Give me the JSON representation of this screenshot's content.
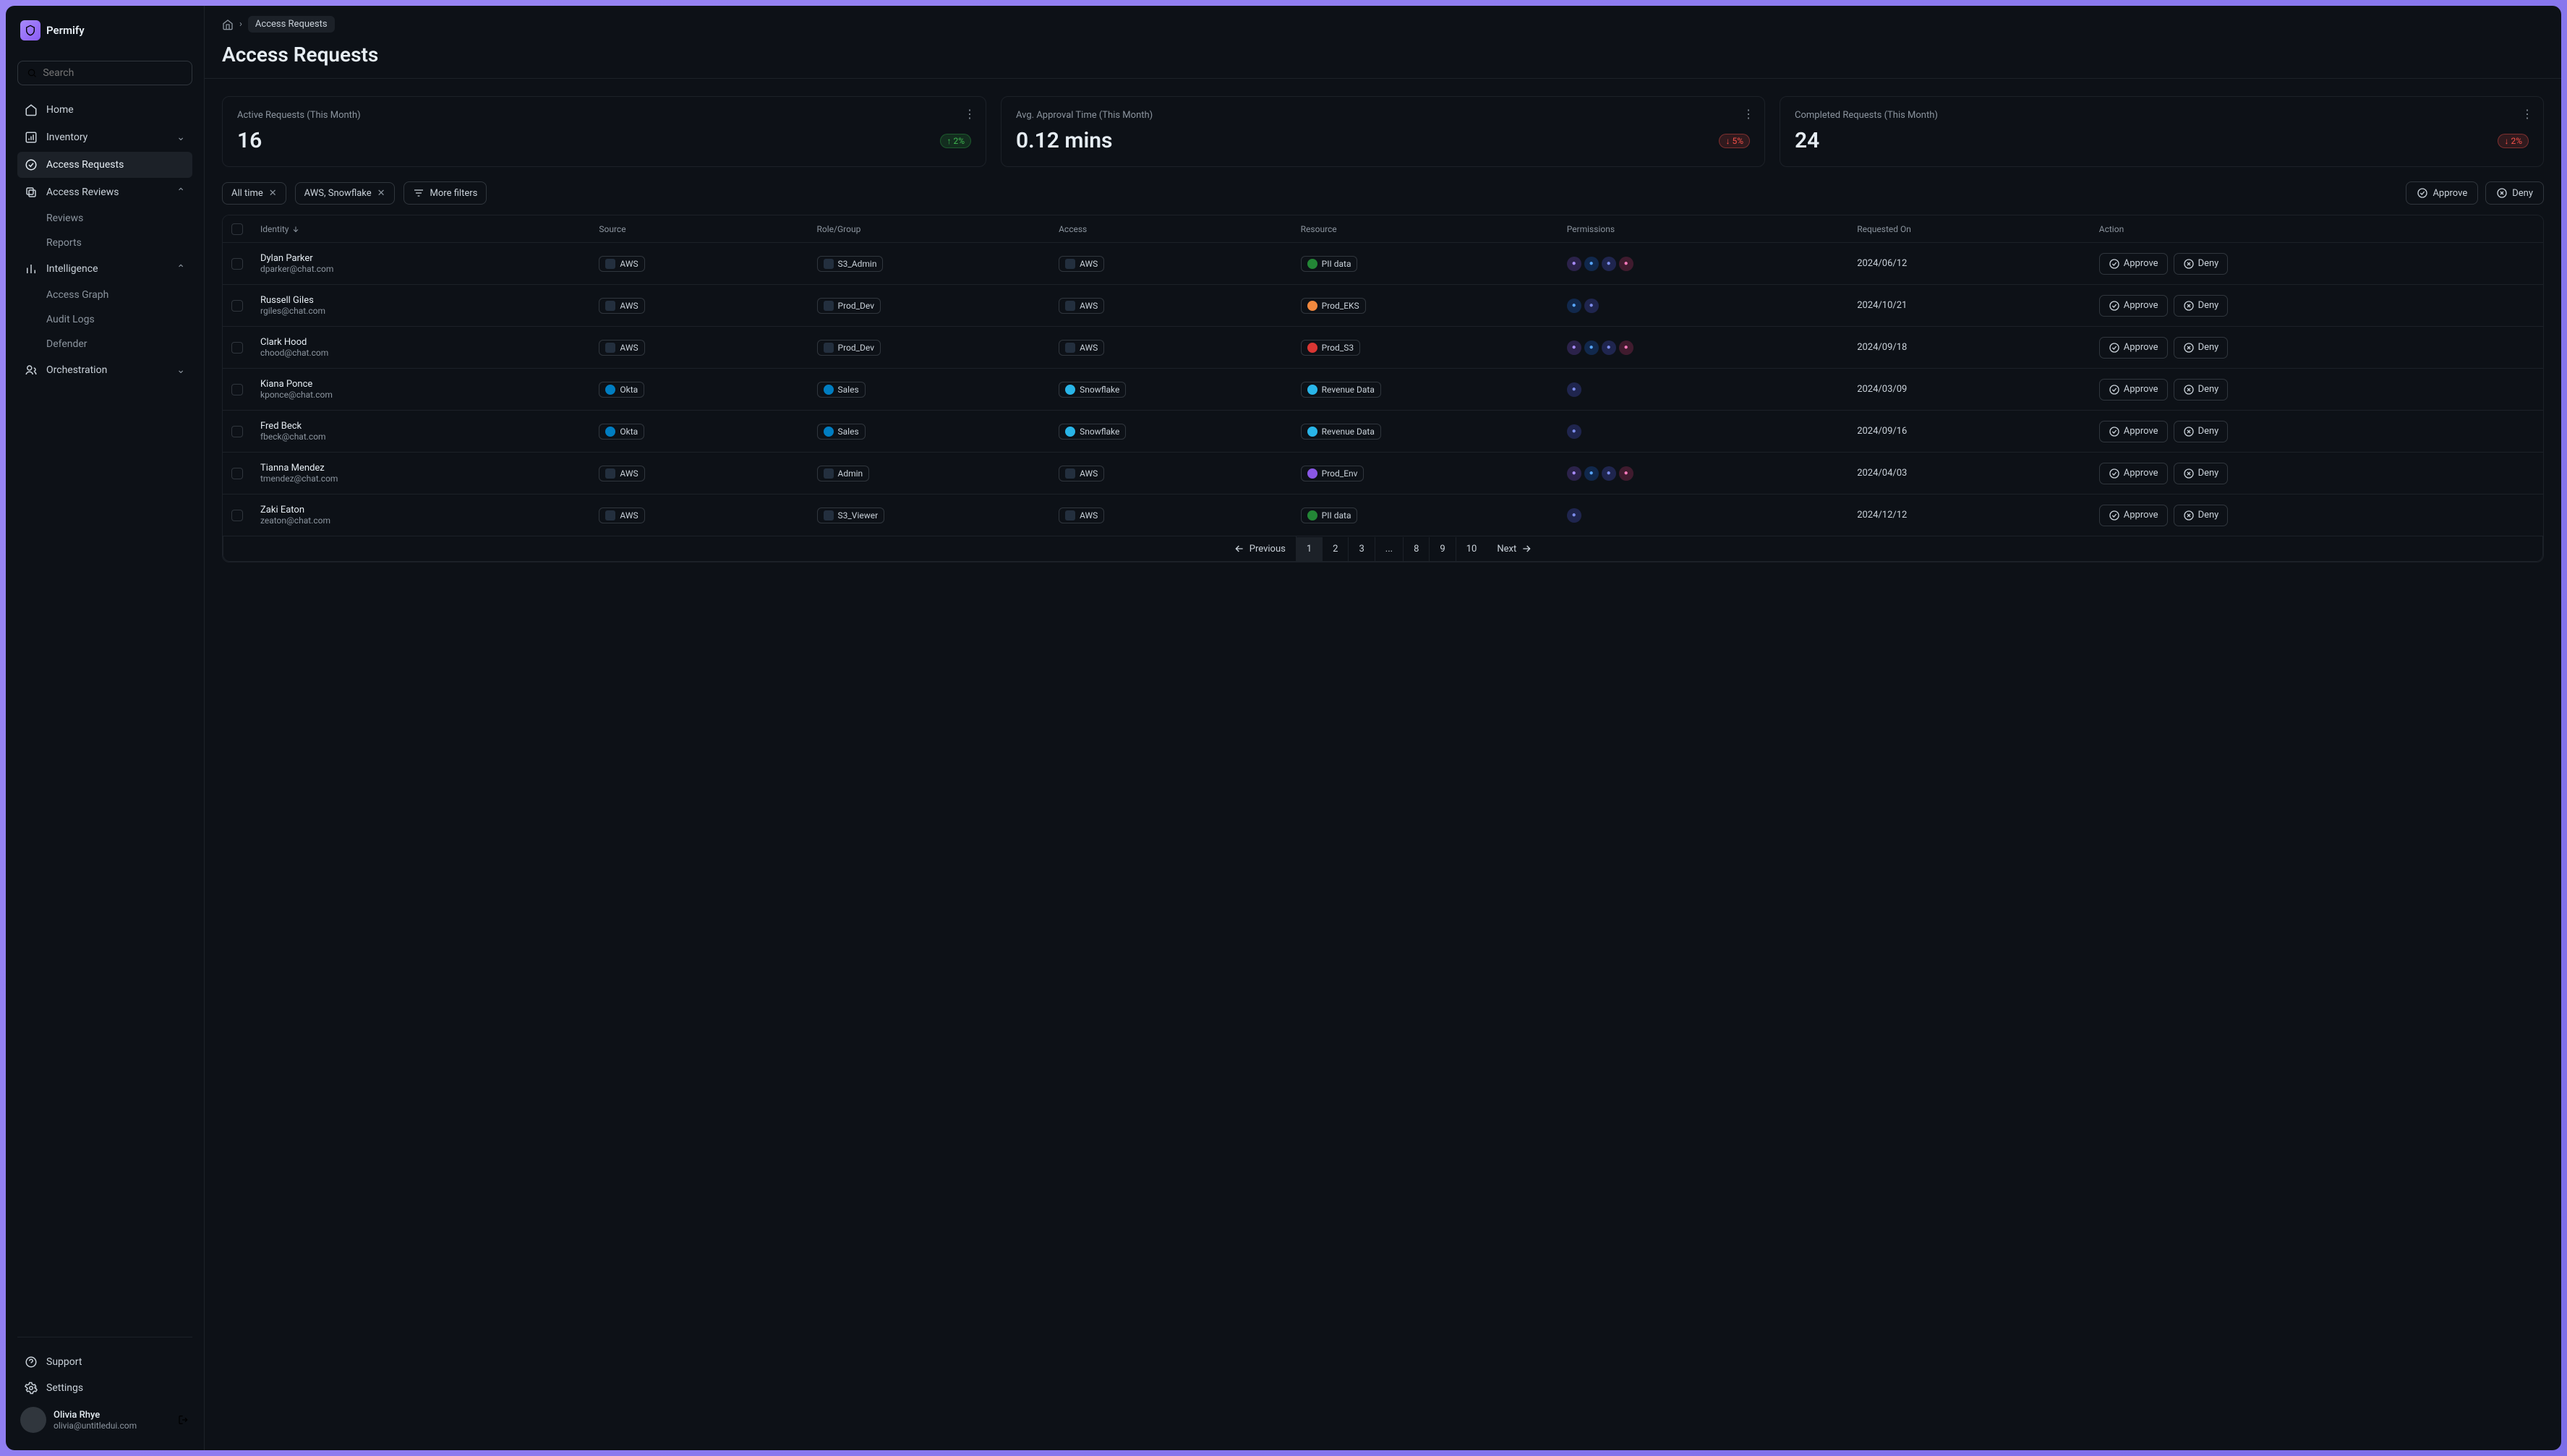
{
  "app": {
    "name": "Permify"
  },
  "search": {
    "placeholder": "Search"
  },
  "nav": {
    "home": "Home",
    "inventory": "Inventory",
    "access_requests": "Access Requests",
    "access_reviews": "Access Reviews",
    "reviews": "Reviews",
    "reports": "Reports",
    "intelligence": "Intelligence",
    "access_graph": "Access Graph",
    "audit_logs": "Audit Logs",
    "defender": "Defender",
    "orchestration": "Orchestration",
    "support": "Support",
    "settings": "Settings"
  },
  "user": {
    "name": "Olivia Rhye",
    "email": "olivia@untitledui.com"
  },
  "breadcrumb": {
    "current": "Access Requests"
  },
  "page_title": "Access Requests",
  "stats": [
    {
      "label": "Active Requests (This Month)",
      "value": "16",
      "delta": "2%",
      "dir": "up"
    },
    {
      "label": "Avg. Approval Time (This Month)",
      "value": "0.12 mins",
      "delta": "5%",
      "dir": "down"
    },
    {
      "label": "Completed Requests (This Month)",
      "value": "24",
      "delta": "2%",
      "dir": "down"
    }
  ],
  "filters": {
    "time": "All time",
    "source": "AWS, Snowflake",
    "more": "More filters"
  },
  "bulk": {
    "approve": "Approve",
    "deny": "Deny"
  },
  "columns": {
    "identity": "Identity",
    "source": "Source",
    "role": "Role/Group",
    "access": "Access",
    "resource": "Resource",
    "permissions": "Permissions",
    "requested": "Requested On",
    "action": "Action"
  },
  "rows": [
    {
      "name": "Dylan Parker",
      "email": "dparker@chat.com",
      "source": "AWS",
      "role": "S3_Admin",
      "access": "AWS",
      "resource": "PII data",
      "res_color": "green",
      "perms": [
        "purple",
        "blue",
        "indigo",
        "pink"
      ],
      "date": "2024/06/12"
    },
    {
      "name": "Russell Giles",
      "email": "rgiles@chat.com",
      "source": "AWS",
      "role": "Prod_Dev",
      "access": "AWS",
      "resource": "Prod_EKS",
      "res_color": "orange",
      "perms": [
        "blue",
        "indigo"
      ],
      "date": "2024/10/21"
    },
    {
      "name": "Clark Hood",
      "email": "chood@chat.com",
      "source": "AWS",
      "role": "Prod_Dev",
      "access": "AWS",
      "resource": "Prod_S3",
      "res_color": "red",
      "perms": [
        "purple",
        "blue",
        "indigo",
        "pink"
      ],
      "date": "2024/09/18"
    },
    {
      "name": "Kiana Ponce",
      "email": "kponce@chat.com",
      "source": "Okta",
      "role": "Sales",
      "access": "Snowflake",
      "resource": "Revenue Data",
      "res_color": "snow",
      "perms": [
        "indigo"
      ],
      "date": "2024/03/09"
    },
    {
      "name": "Fred Beck",
      "email": "fbeck@chat.com",
      "source": "Okta",
      "role": "Sales",
      "access": "Snowflake",
      "resource": "Revenue Data",
      "res_color": "snow",
      "perms": [
        "indigo"
      ],
      "date": "2024/09/16"
    },
    {
      "name": "Tianna Mendez",
      "email": "tmendez@chat.com",
      "source": "AWS",
      "role": "Admin",
      "access": "AWS",
      "resource": "Prod_Env",
      "res_color": "purple",
      "perms": [
        "purple",
        "blue",
        "indigo",
        "pink"
      ],
      "date": "2024/04/03"
    },
    {
      "name": "Zaki Eaton",
      "email": "zeaton@chat.com",
      "source": "AWS",
      "role": "S3_Viewer",
      "access": "AWS",
      "resource": "PII data",
      "res_color": "green",
      "perms": [
        "indigo"
      ],
      "date": "2024/12/12"
    }
  ],
  "row_actions": {
    "approve": "Approve",
    "deny": "Deny"
  },
  "pagination": {
    "prev": "Previous",
    "next": "Next",
    "pages": [
      "1",
      "2",
      "3",
      "...",
      "8",
      "9",
      "10"
    ]
  }
}
